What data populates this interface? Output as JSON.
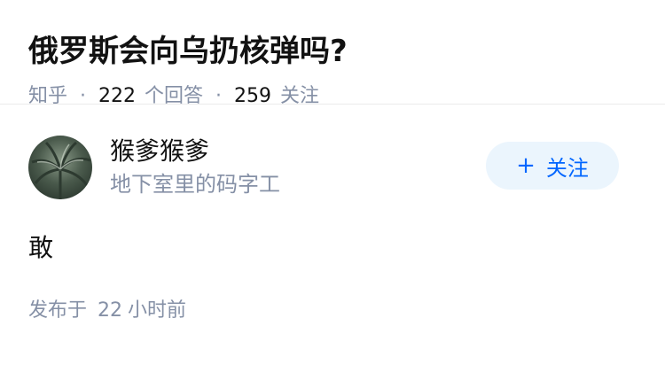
{
  "question": {
    "title": "俄罗斯会向乌扔核弹吗?",
    "source": "知乎",
    "separator": "·",
    "answer_count": "222",
    "answer_label": "个回答",
    "follower_count": "259",
    "follower_label": "关注"
  },
  "answer": {
    "author_name": "猴爹猴爹",
    "author_bio": "地下室里的码字工",
    "follow_icon": "+",
    "follow_label": "关注",
    "content": "敢",
    "published_prefix": "发布于",
    "published_num": "22",
    "published_unit": "小时前"
  },
  "colors": {
    "accent": "#0066ff",
    "follow_bg": "#ebf5fd",
    "meta": "#8590a6"
  }
}
